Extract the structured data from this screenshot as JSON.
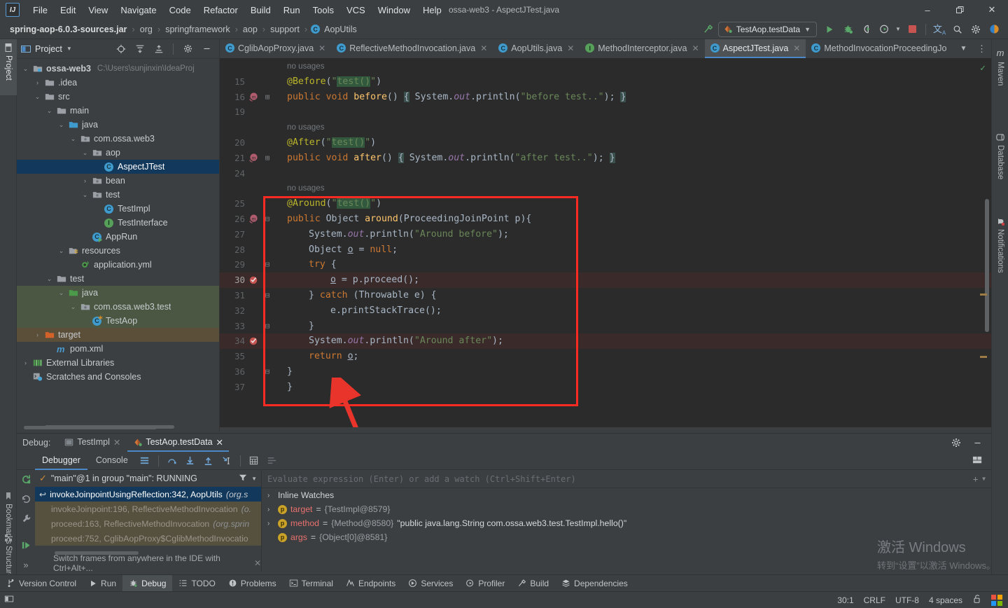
{
  "window": {
    "title": "ossa-web3 - AspectJTest.java",
    "app_icon": "IJ",
    "minimize": "–",
    "maximize": "❐",
    "close": "✕"
  },
  "menubar": {
    "items": [
      "File",
      "Edit",
      "View",
      "Navigate",
      "Code",
      "Refactor",
      "Build",
      "Run",
      "Tools",
      "VCS",
      "Window",
      "Help"
    ]
  },
  "breadcrumb": {
    "items": [
      "spring-aop-6.0.3-sources.jar",
      "org",
      "springframework",
      "aop",
      "support",
      "AopUtils"
    ],
    "last_icon": "C",
    "separator": "›"
  },
  "toolbar": {
    "build_label": "build-hammer-icon",
    "run_config": "TestAop.testData",
    "run_label": "run-icon",
    "debug_label": "debug-icon",
    "run_coverage_label": "run-with-coverage-icon",
    "profile_label": "profiler-icon",
    "stop_label": "stop-icon",
    "translate_label": "translate-icon",
    "search_label": "search-icon",
    "settings_label": "settings-icon",
    "ai_label": "ai-assistant-icon"
  },
  "left_strip": {
    "tabs": [
      "Project",
      "Bookmarks",
      "Structure"
    ],
    "active": "Project"
  },
  "right_strip": {
    "tabs": [
      "Maven",
      "Database",
      "Notifications"
    ]
  },
  "project_panel": {
    "title": "Project",
    "header_icons": [
      "locate-icon",
      "expand-all-icon",
      "collapse-all-icon",
      "settings-icon",
      "hide-icon"
    ],
    "tree": [
      {
        "depth": 0,
        "arrow": "⌄",
        "icon": "module-folder",
        "label": "ossa-web3",
        "sublabel": "C:\\Users\\sunjinxin\\IdeaProj",
        "bold": true,
        "state": "none"
      },
      {
        "depth": 1,
        "arrow": "›",
        "icon": "folder",
        "label": ".idea",
        "state": "none"
      },
      {
        "depth": 1,
        "arrow": "⌄",
        "icon": "folder",
        "label": "src",
        "state": "none"
      },
      {
        "depth": 2,
        "arrow": "⌄",
        "icon": "folder",
        "label": "main",
        "state": "none"
      },
      {
        "depth": 3,
        "arrow": "⌄",
        "icon": "source-folder",
        "label": "java",
        "state": "none"
      },
      {
        "depth": 4,
        "arrow": "⌄",
        "icon": "package",
        "label": "com.ossa.web3",
        "state": "none"
      },
      {
        "depth": 5,
        "arrow": "⌄",
        "icon": "package",
        "label": "aop",
        "state": "none"
      },
      {
        "depth": 6,
        "arrow": "",
        "icon": "class-c",
        "label": "AspectJTest",
        "state": "selected"
      },
      {
        "depth": 5,
        "arrow": "›",
        "icon": "package",
        "label": "bean",
        "state": "none"
      },
      {
        "depth": 5,
        "arrow": "⌄",
        "icon": "package",
        "label": "test",
        "state": "none"
      },
      {
        "depth": 6,
        "arrow": "",
        "icon": "class-c",
        "label": "TestImpl",
        "state": "none"
      },
      {
        "depth": 6,
        "arrow": "",
        "icon": "interface-i",
        "label": "TestInterface",
        "state": "none"
      },
      {
        "depth": 5,
        "arrow": "",
        "icon": "runnable-class",
        "label": "AppRun",
        "state": "none"
      },
      {
        "depth": 3,
        "arrow": "⌄",
        "icon": "resource-folder",
        "label": "resources",
        "state": "none"
      },
      {
        "depth": 4,
        "arrow": "",
        "icon": "yaml-file",
        "label": "application.yml",
        "state": "none"
      },
      {
        "depth": 2,
        "arrow": "⌄",
        "icon": "folder",
        "label": "test",
        "state": "none"
      },
      {
        "depth": 3,
        "arrow": "⌄",
        "icon": "test-source-folder",
        "label": "java",
        "state": "ctx-green"
      },
      {
        "depth": 4,
        "arrow": "⌄",
        "icon": "package",
        "label": "com.ossa.web3.test",
        "state": "ctx-green"
      },
      {
        "depth": 5,
        "arrow": "",
        "icon": "test-class",
        "label": "TestAop",
        "state": "ctx-green"
      },
      {
        "depth": 1,
        "arrow": "›",
        "icon": "target-folder",
        "label": "target",
        "state": "ctx-brown"
      },
      {
        "depth": 2,
        "arrow": "",
        "icon": "maven-file",
        "label": "pom.xml",
        "state": "none"
      },
      {
        "depth": 0,
        "arrow": "›",
        "icon": "libraries",
        "label": "External Libraries",
        "state": "none"
      },
      {
        "depth": 0,
        "arrow": "",
        "icon": "scratches",
        "label": "Scratches and Consoles",
        "state": "none"
      }
    ]
  },
  "editor": {
    "tabs": [
      {
        "label": "CglibAopProxy.java",
        "icon": "class-c",
        "active": false
      },
      {
        "label": "ReflectiveMethodInvocation.java",
        "icon": "class-c",
        "active": false
      },
      {
        "label": "AopUtils.java",
        "icon": "class-c",
        "active": false
      },
      {
        "label": "MethodInterceptor.java",
        "icon": "interface-i",
        "active": false
      },
      {
        "label": "AspectJTest.java",
        "icon": "class-c",
        "active": true
      },
      {
        "label": "MethodInvocationProceedingJo",
        "icon": "class-c",
        "active": false
      }
    ],
    "tab_overflow_icon": "chevron-down-icon",
    "tab_menu_icon": "more-vertical-icon",
    "inspection_status": "✓",
    "lines": [
      {
        "num": "",
        "type": "hint",
        "text": "no usages",
        "indent": 0,
        "mark": ""
      },
      {
        "num": "15",
        "type": "code",
        "indent": 0,
        "mark": "",
        "tokens": [
          {
            "c": "ann",
            "t": "@Before"
          },
          {
            "c": "txt",
            "t": "("
          },
          {
            "c": "str",
            "t": "\""
          },
          {
            "c": "search-hl str",
            "t": "test()"
          },
          {
            "c": "str",
            "t": "\""
          },
          {
            "c": "txt",
            "t": ")"
          }
        ]
      },
      {
        "num": "16",
        "type": "code",
        "indent": 0,
        "mark": "method-run-icon",
        "fold": "+",
        "tokens": [
          {
            "c": "kw",
            "t": "public "
          },
          {
            "c": "kw",
            "t": "void "
          },
          {
            "c": "mth",
            "t": "before"
          },
          {
            "c": "txt",
            "t": "() "
          },
          {
            "c": "brace-hl txt",
            "t": "{"
          },
          {
            "c": "txt",
            "t": " System."
          },
          {
            "c": "fld",
            "t": "out"
          },
          {
            "c": "txt",
            "t": ".println("
          },
          {
            "c": "str",
            "t": "\"before test..\""
          },
          {
            "c": "txt",
            "t": "); "
          },
          {
            "c": "brace-hl txt",
            "t": "}"
          }
        ]
      },
      {
        "num": "19",
        "type": "code",
        "indent": 0,
        "mark": "",
        "tokens": []
      },
      {
        "num": "",
        "type": "hint",
        "text": "no usages",
        "indent": 0,
        "mark": ""
      },
      {
        "num": "20",
        "type": "code",
        "indent": 0,
        "mark": "",
        "tokens": [
          {
            "c": "ann",
            "t": "@After"
          },
          {
            "c": "txt",
            "t": "("
          },
          {
            "c": "str",
            "t": "\""
          },
          {
            "c": "search-hl str",
            "t": "test()"
          },
          {
            "c": "str",
            "t": "\""
          },
          {
            "c": "txt",
            "t": ")"
          }
        ]
      },
      {
        "num": "21",
        "type": "code",
        "indent": 0,
        "mark": "method-run-icon",
        "fold": "+",
        "tokens": [
          {
            "c": "kw",
            "t": "public "
          },
          {
            "c": "kw",
            "t": "void "
          },
          {
            "c": "mth",
            "t": "after"
          },
          {
            "c": "txt",
            "t": "() "
          },
          {
            "c": "brace-hl txt",
            "t": "{"
          },
          {
            "c": "txt",
            "t": " System."
          },
          {
            "c": "fld",
            "t": "out"
          },
          {
            "c": "txt",
            "t": ".println("
          },
          {
            "c": "str",
            "t": "\"after test..\""
          },
          {
            "c": "txt",
            "t": "); "
          },
          {
            "c": "brace-hl txt",
            "t": "}"
          }
        ]
      },
      {
        "num": "24",
        "type": "code",
        "indent": 0,
        "mark": "",
        "tokens": []
      },
      {
        "num": "",
        "type": "hint",
        "text": "no usages",
        "indent": 0,
        "mark": ""
      },
      {
        "num": "25",
        "type": "code",
        "indent": 0,
        "mark": "",
        "tokens": [
          {
            "c": "ann",
            "t": "@Around"
          },
          {
            "c": "txt",
            "t": "("
          },
          {
            "c": "str",
            "t": "\""
          },
          {
            "c": "search-hl str",
            "t": "test()"
          },
          {
            "c": "str",
            "t": "\""
          },
          {
            "c": "txt",
            "t": ")"
          }
        ]
      },
      {
        "num": "26",
        "type": "code",
        "indent": 0,
        "mark": "method-run-icon",
        "fold": "-",
        "tokens": [
          {
            "c": "kw",
            "t": "public "
          },
          {
            "c": "txt",
            "t": "Object "
          },
          {
            "c": "mth",
            "t": "around"
          },
          {
            "c": "txt",
            "t": "(ProceedingJoinPoint p){"
          }
        ]
      },
      {
        "num": "27",
        "type": "code",
        "indent": 1,
        "mark": "",
        "tokens": [
          {
            "c": "txt",
            "t": "System."
          },
          {
            "c": "fld",
            "t": "out"
          },
          {
            "c": "txt",
            "t": ".println("
          },
          {
            "c": "str",
            "t": "\"Around before\""
          },
          {
            "c": "txt",
            "t": ");"
          }
        ]
      },
      {
        "num": "28",
        "type": "code",
        "indent": 1,
        "mark": "",
        "tokens": [
          {
            "c": "txt",
            "t": "Object "
          },
          {
            "c": "var-u",
            "t": "o"
          },
          {
            "c": "txt",
            "t": " = "
          },
          {
            "c": "kw",
            "t": "null"
          },
          {
            "c": "txt",
            "t": ";"
          }
        ]
      },
      {
        "num": "29",
        "type": "code",
        "indent": 1,
        "mark": "",
        "fold": "-",
        "tokens": [
          {
            "c": "kw",
            "t": "try"
          },
          {
            "c": "txt",
            "t": " {"
          }
        ]
      },
      {
        "num": "30",
        "type": "code",
        "indent": 2,
        "mark": "breakpoint-verified",
        "hl": true,
        "tokens": [
          {
            "c": "var-u",
            "t": "o"
          },
          {
            "c": "txt",
            "t": " = p.proceed();"
          }
        ]
      },
      {
        "num": "31",
        "type": "code",
        "indent": 1,
        "mark": "",
        "fold": "-",
        "tokens": [
          {
            "c": "txt",
            "t": "} "
          },
          {
            "c": "kw",
            "t": "catch"
          },
          {
            "c": "txt",
            "t": " (Throwable e) {"
          }
        ]
      },
      {
        "num": "32",
        "type": "code",
        "indent": 2,
        "mark": "",
        "tokens": [
          {
            "c": "txt",
            "t": "e.printStackTrace();"
          }
        ]
      },
      {
        "num": "33",
        "type": "code",
        "indent": 1,
        "mark": "",
        "fold": "-",
        "tokens": [
          {
            "c": "txt",
            "t": "}"
          }
        ]
      },
      {
        "num": "34",
        "type": "code",
        "indent": 1,
        "mark": "breakpoint-verified",
        "hl": true,
        "tokens": [
          {
            "c": "txt",
            "t": "System."
          },
          {
            "c": "fld",
            "t": "out"
          },
          {
            "c": "txt",
            "t": ".println("
          },
          {
            "c": "str",
            "t": "\"Around after\""
          },
          {
            "c": "txt",
            "t": ");"
          }
        ]
      },
      {
        "num": "35",
        "type": "code",
        "indent": 1,
        "mark": "",
        "tokens": [
          {
            "c": "kw",
            "t": "return "
          },
          {
            "c": "var-u",
            "t": "o"
          },
          {
            "c": "txt",
            "t": ";"
          }
        ]
      },
      {
        "num": "36",
        "type": "code",
        "indent": 0,
        "mark": "",
        "fold": "-",
        "tokens": [
          {
            "c": "txt",
            "t": "}"
          }
        ]
      },
      {
        "num": "37",
        "type": "code",
        "indent": 0,
        "mark": "",
        "tokens": [
          {
            "c": "txt",
            "t": "}"
          }
        ]
      }
    ]
  },
  "debug": {
    "title": "Debug:",
    "tabs": [
      {
        "label": "TestImpl",
        "icon": "run-config-icon",
        "active": false
      },
      {
        "label": "TestAop.testData",
        "icon": "test-run-icon",
        "active": true
      }
    ],
    "settings_icon": "settings-icon",
    "hide_icon": "hide-icon",
    "layout_icon": "layout-settings-icon",
    "toolbar_tabs": [
      {
        "label": "Debugger",
        "active": true
      },
      {
        "label": "Console",
        "active": false
      }
    ],
    "toolbar_icons": [
      "frames-icon",
      "step-over-icon",
      "step-into-icon",
      "step-out-icon",
      "run-to-cursor-icon",
      "evaluate-icon",
      "mute-breakpoints-icon"
    ],
    "side_icons": [
      "rerun-icon",
      "restart-icon",
      "settings-wrench-icon",
      "resume-icon",
      "more-icon"
    ],
    "thread": "\"main\"@1 in group \"main\": RUNNING",
    "thread_filter_icon": "filter-icon",
    "thread_dropdown_icon": "chevron-down-icon",
    "frames": [
      {
        "label": "invokeJoinpointUsingReflection:342, AopUtils",
        "pkg": "(org.s",
        "state": "selected"
      },
      {
        "label": "invokeJoinpoint:196, ReflectiveMethodInvocation",
        "pkg": "(o.",
        "state": "dim"
      },
      {
        "label": "proceed:163, ReflectiveMethodInvocation",
        "pkg": "(org.sprin",
        "state": "dim"
      },
      {
        "label": "proceed:752, CglibAopProxy$CglibMethodInvocatio",
        "pkg": "",
        "state": "dim"
      }
    ],
    "hint": "Switch frames from anywhere in the IDE with Ctrl+Alt+...",
    "hint_close": "✕",
    "evaluate_placeholder": "Evaluate expression (Enter) or add a watch (Ctrl+Shift+Enter)",
    "evaluate_add_icon": "+",
    "evaluate_menu_icon": "chevron-down-icon",
    "watches": [
      {
        "arrow": "›",
        "icon": "",
        "name": "Inline Watches",
        "eq": "",
        "value": "",
        "str": ""
      },
      {
        "arrow": "›",
        "icon": "p",
        "name": "target",
        "eq": " = ",
        "value": "{TestImpl@8579}",
        "str": ""
      },
      {
        "arrow": "›",
        "icon": "p",
        "name": "method",
        "eq": " = ",
        "value": "{Method@8580}",
        "str": "\"public java.lang.String com.ossa.web3.test.TestImpl.hello()\""
      },
      {
        "arrow": "",
        "icon": "p",
        "name": "args",
        "eq": " = ",
        "value": "{Object[0]@8581}",
        "str": ""
      }
    ]
  },
  "bottom_bar": {
    "items": [
      {
        "label": "Version Control",
        "icon": "branch-icon",
        "active": false
      },
      {
        "label": "Run",
        "icon": "run-icon",
        "active": false
      },
      {
        "label": "Debug",
        "icon": "debug-icon",
        "active": true
      },
      {
        "label": "TODO",
        "icon": "todo-icon",
        "active": false
      },
      {
        "label": "Problems",
        "icon": "problems-icon",
        "active": false
      },
      {
        "label": "Terminal",
        "icon": "terminal-icon",
        "active": false
      },
      {
        "label": "Endpoints",
        "icon": "endpoints-icon",
        "active": false
      },
      {
        "label": "Services",
        "icon": "services-icon",
        "active": false
      },
      {
        "label": "Profiler",
        "icon": "profiler-icon",
        "active": false
      },
      {
        "label": "Build",
        "icon": "build-icon",
        "active": false
      },
      {
        "label": "Dependencies",
        "icon": "dependencies-icon",
        "active": false
      }
    ]
  },
  "status_bar": {
    "left_icon": "show-tool-windows-icon",
    "caret": "30:1",
    "line_sep": "CRLF",
    "encoding": "UTF-8",
    "indent": "4 spaces",
    "lock_icon": "unlocked-icon",
    "os_icon": "windows-logo"
  },
  "watermark": {
    "line1": "激活 Windows",
    "line2": "转到“设置”以激活 Windows。"
  },
  "colors": {
    "accent": "#4a88c7",
    "selection": "#12385c",
    "editor_bg": "#2b2b2b",
    "chrome_bg": "#3c3f41",
    "redbox": "#ff2a21",
    "green": "#59a869"
  }
}
